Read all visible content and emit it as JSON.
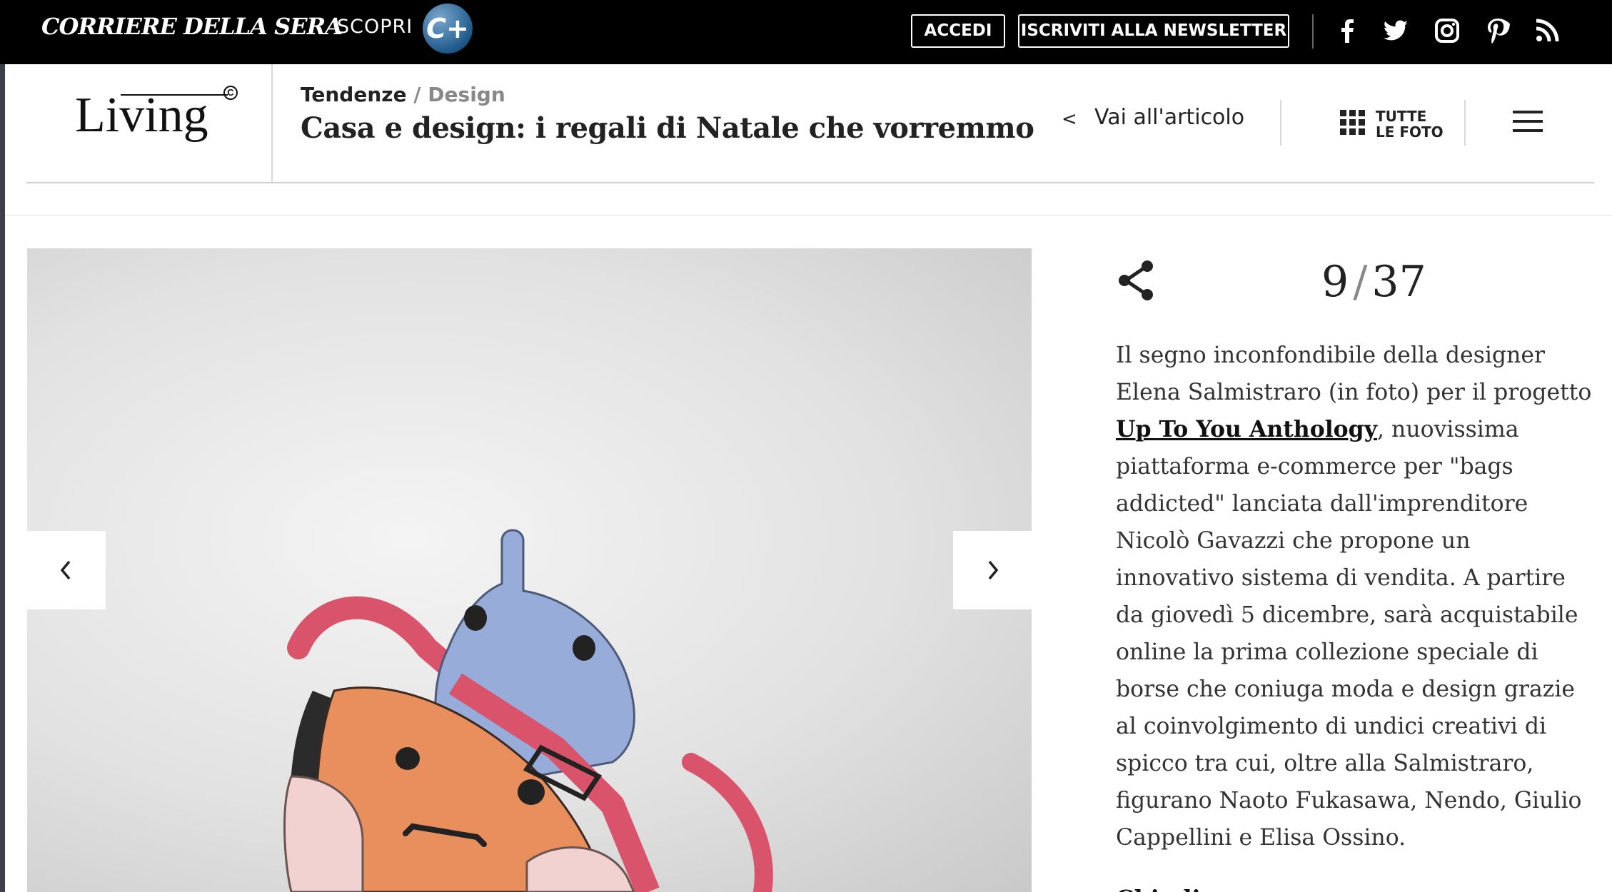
{
  "topbar": {
    "brand": "CORRIERE DELLA SERA",
    "scopri": "SCOPRI",
    "cplus": "C+",
    "login_label": "ACCEDI",
    "newsletter_label": "ISCRIVITI ALLA NEWSLETTER",
    "social": [
      "facebook-icon",
      "twitter-icon",
      "instagram-icon",
      "pinterest-icon",
      "rss-icon"
    ]
  },
  "header": {
    "logo": "Living",
    "logo_mark": "C",
    "breadcrumb": {
      "section": "Tendenze",
      "separator": " / ",
      "subsection": "Design"
    },
    "title": "Casa e design: i regali di Natale che vorremmo",
    "back_chevron": "<",
    "back_label": "Vai all'articolo",
    "all_photos_line1": "TUTTE",
    "all_photos_line2": "LE FOTO"
  },
  "gallery": {
    "current": "9",
    "separator": "/",
    "total": "37",
    "caption_before": "Il segno inconfondibile della designer Elena Salmistraro (in foto) per il progetto ",
    "caption_link": "Up To You Anthology",
    "caption_after": ", nuovissima piattaforma e-commerce per \"bags addicted\" lanciata dall'imprenditore Nicolò Gavazzi che propone un innovativo sistema di vendita. A partire da giovedì 5 dicembre, sarà acquistabile online la prima collezione speciale di borse che coniuga moda e design grazie al coinvolgimento di undici creativi di spicco tra cui, oltre alla Salmistraro, figurano Naoto Fukasawa, Nendo, Giulio Cappellini e Elisa Ossino.",
    "close_label": "Chiudi"
  },
  "colors": {
    "topbar_bg": "#000000",
    "bag_blue": "#97acd9",
    "bag_orange": "#e98f5d",
    "bag_pink_strap": "#d9536a",
    "bag_light_pink": "#f1d2d0"
  }
}
